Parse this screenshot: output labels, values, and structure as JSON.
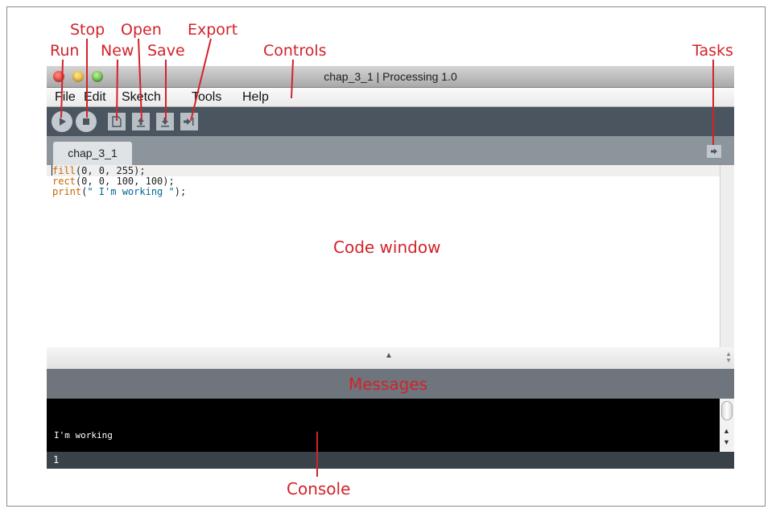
{
  "window": {
    "title": "chap_3_1 | Processing 1.0"
  },
  "menubar": {
    "items": [
      "File",
      "Edit",
      "Sketch",
      "Tools",
      "Help"
    ]
  },
  "toolbar": {
    "buttons": [
      {
        "name": "Run",
        "icon": "play-icon"
      },
      {
        "name": "Stop",
        "icon": "stop-icon"
      },
      {
        "name": "New",
        "icon": "new-file-icon"
      },
      {
        "name": "Open",
        "icon": "open-arrow-up-icon"
      },
      {
        "name": "Save",
        "icon": "save-arrow-down-icon"
      },
      {
        "name": "Export",
        "icon": "export-arrow-right-icon"
      }
    ]
  },
  "tabs": {
    "items": [
      "chap_3_1"
    ],
    "tasks_icon": "arrow-right-icon"
  },
  "code": {
    "lines": [
      {
        "kw": "fill",
        "rest": "(0, 0, 255);"
      },
      {
        "kw": "rect",
        "rest": "(0, 0, 100, 100);"
      },
      {
        "kw": "print",
        "open": "(",
        "str": "\" I'm working \"",
        "close": ");"
      }
    ]
  },
  "console": {
    "output": "I'm working"
  },
  "status": {
    "line_number": "1"
  },
  "annotations": {
    "run": "Run",
    "stop": "Stop",
    "new": "New",
    "open": "Open",
    "save": "Save",
    "export": "Export",
    "controls": "Controls",
    "tasks": "Tasks",
    "code_window": "Code window",
    "messages": "Messages",
    "console": "Console"
  },
  "colors": {
    "annotation": "#d2232a",
    "keyword": "#cc6600",
    "string": "#006699",
    "toolbar": "#4b5560"
  }
}
